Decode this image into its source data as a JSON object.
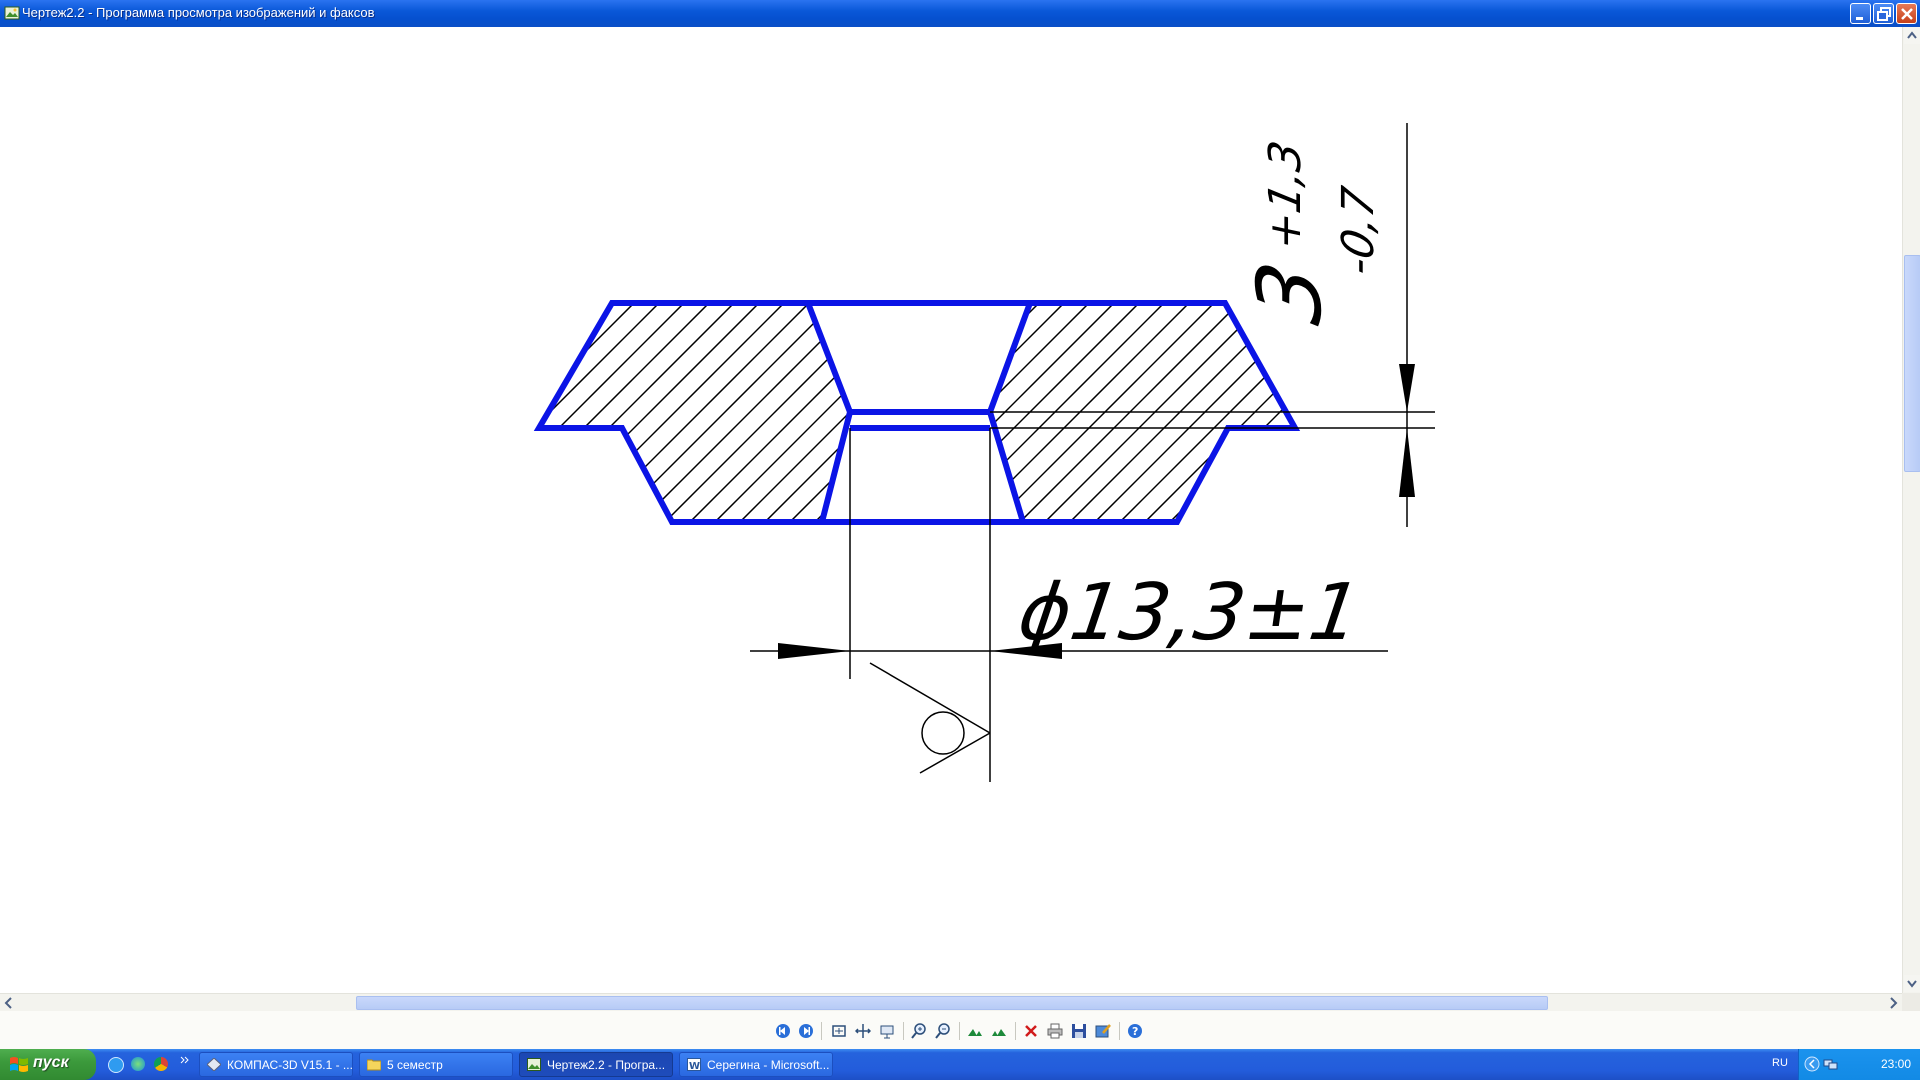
{
  "window": {
    "title": "Чертеж2.2 - Программа просмотра изображений и факсов"
  },
  "drawing": {
    "dim_thickness_nominal": "3",
    "dim_thickness_upper": "+1,3",
    "dim_thickness_lower": "-0,7",
    "dim_diameter": "ϕ13,3±1",
    "colors": {
      "outline": "#0b14e6",
      "lines": "#000000"
    }
  },
  "toolbar": {
    "icons": [
      "prev-image-icon",
      "next-image-icon",
      "best-fit-icon",
      "actual-size-icon",
      "slideshow-icon",
      "zoom-in-icon",
      "zoom-out-icon",
      "rotate-cw-icon",
      "rotate-ccw-icon",
      "delete-icon",
      "print-icon",
      "save-icon",
      "edit-icon",
      "help-icon"
    ]
  },
  "taskbar": {
    "start_label": "пуск",
    "tasks": [
      {
        "label": "КОМПАС-3D V15.1 - ...",
        "icon": "kompas-icon"
      },
      {
        "label": "5 семестр",
        "icon": "folder-icon"
      },
      {
        "label": "Чертеж2.2 - Програ...",
        "icon": "image-viewer-icon",
        "active": true
      },
      {
        "label": "Серегина - Microsoft...",
        "icon": "word-icon"
      }
    ],
    "language": "RU",
    "clock": "23:00"
  }
}
